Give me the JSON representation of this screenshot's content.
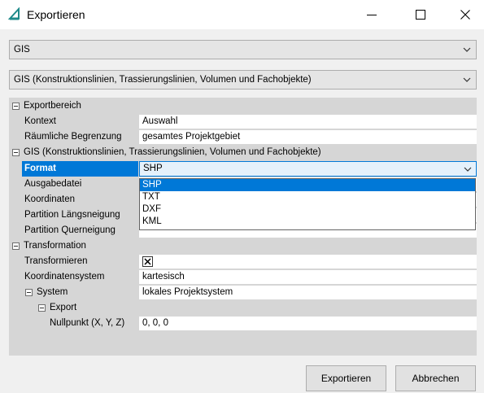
{
  "window": {
    "title": "Exportieren",
    "accent_color": "#0078d7"
  },
  "dropdowns": {
    "category": "GIS",
    "variant": "GIS (Konstruktionslinien, Trassierungslinien, Volumen und Fachobjekte)"
  },
  "grid": {
    "exportbereich": {
      "header": "Exportbereich",
      "kontext_label": "Kontext",
      "kontext_value": "Auswahl",
      "begrenzung_label": "Räumliche Begrenzung",
      "begrenzung_value": "gesamtes Projektgebiet"
    },
    "gis": {
      "header": "GIS (Konstruktionslinien, Trassierungslinien, Volumen und Fachobjekte)",
      "format_label": "Format",
      "format_value": "SHP",
      "ausgabedatei_label": "Ausgabedatei",
      "koordinaten_label": "Koordinaten",
      "partition_laengs_label": "Partition Längsneigung",
      "partition_quer_label": "Partition Querneigung"
    },
    "transformation": {
      "header": "Transformation",
      "transformieren_label": "Transformieren",
      "transformieren_checked": true,
      "koordinatensystem_label": "Koordinatensystem",
      "koordinatensystem_value": "kartesisch",
      "system_label": "System",
      "system_value": "lokales Projektsystem",
      "export_label": "Export",
      "nullpunkt_label": "Nullpunkt (X, Y, Z)",
      "nullpunkt_value": "0, 0, 0"
    }
  },
  "format_options": [
    "SHP",
    "TXT",
    "DXF",
    "KML"
  ],
  "format_selected": "SHP",
  "buttons": {
    "export": "Exportieren",
    "cancel": "Abbrechen"
  },
  "icons": {
    "app": "triangle-ruler-icon",
    "minimize": "minimize-icon",
    "maximize": "maximize-icon",
    "close": "close-icon",
    "dropdown": "chevron-down-icon",
    "collapse": "collapse-minus-icon",
    "checkbox": "checkbox-x-icon"
  }
}
